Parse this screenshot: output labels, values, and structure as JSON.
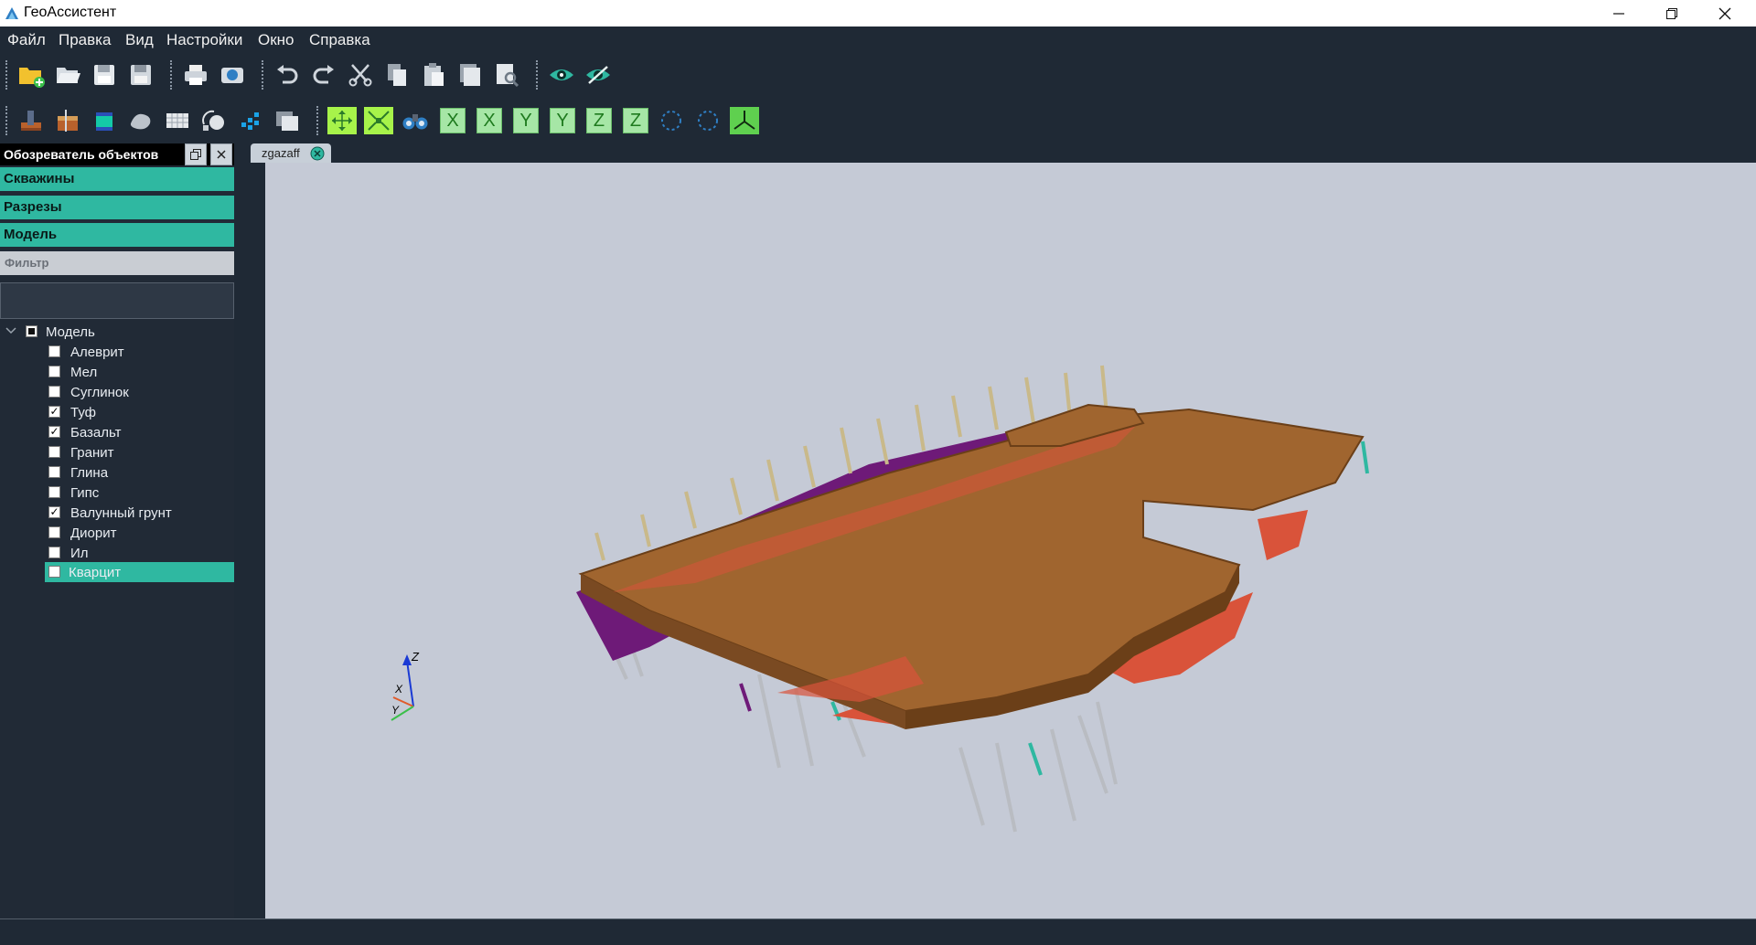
{
  "window": {
    "title": "ГеоАссистент",
    "controls": [
      "minimize",
      "restore",
      "close"
    ]
  },
  "menu": [
    "Файл",
    "Правка",
    "Вид",
    "Настройки",
    "Окно",
    "Справка"
  ],
  "toolbar1": {
    "icons": [
      "new-file-icon",
      "open-folder-icon",
      "save-icon",
      "save-as-icon",
      "print-icon",
      "screenshot-icon",
      "undo-icon",
      "redo-icon",
      "cut-icon",
      "copy-icon",
      "paste-icon",
      "copy-window-icon",
      "print-preview-icon",
      "show-icon",
      "hide-icon"
    ]
  },
  "toolbar2": {
    "icons": [
      "borehole-icon",
      "section-icon",
      "layer-cube-icon",
      "surface-icon",
      "grid-icon",
      "rotate-object-icon",
      "point-cloud-icon",
      "layers-icon",
      "fit-all-icon",
      "fit-selected-icon",
      "binoculars-icon"
    ],
    "axis_buttons": [
      "X",
      "X",
      "Y",
      "Y",
      "Z",
      "Z"
    ],
    "extra_icons": [
      "rotate-cw-icon",
      "rotate-ccw-icon",
      "axes-view-icon"
    ]
  },
  "panel": {
    "title": "Обозреватель объектов",
    "sections": [
      "Скважины",
      "Разрезы",
      "Модель"
    ],
    "filter_label": "Фильтр",
    "filter_value": "",
    "tree_root": "Модель",
    "items": [
      {
        "label": "Алеврит",
        "checked": false
      },
      {
        "label": "Мел",
        "checked": false
      },
      {
        "label": "Суглинок",
        "checked": false
      },
      {
        "label": "Туф",
        "checked": true
      },
      {
        "label": "Базальт",
        "checked": true
      },
      {
        "label": "Гранит",
        "checked": false
      },
      {
        "label": "Глина",
        "checked": false
      },
      {
        "label": "Гипс",
        "checked": false
      },
      {
        "label": "Валунный грунт",
        "checked": true
      },
      {
        "label": "Диорит",
        "checked": false
      },
      {
        "label": "Ил",
        "checked": false
      },
      {
        "label": "Кварцит",
        "checked": false,
        "selected": true
      }
    ]
  },
  "document_tab": {
    "label": "zgazaff"
  },
  "axes_labels": {
    "z": "Z",
    "x": "X",
    "y": "Y"
  },
  "colors": {
    "accent": "#2fb8a1",
    "viewport_bg": "#c5cad6",
    "model_brown": "#a0652f",
    "model_red": "#d9533a",
    "model_purple": "#6e1a78"
  }
}
